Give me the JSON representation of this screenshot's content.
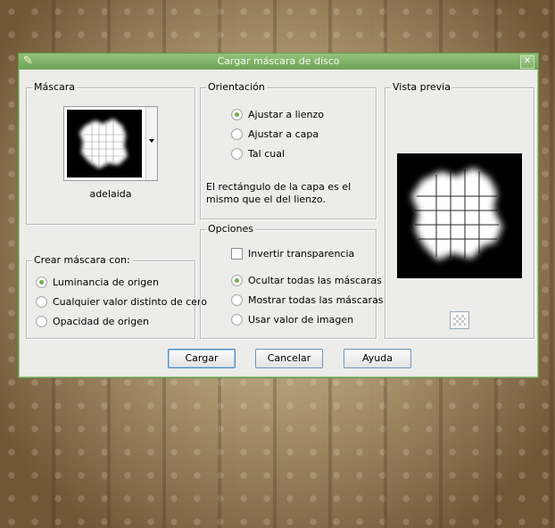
{
  "dialog": {
    "title": "Cargar máscara de disco",
    "close_glyph": "✕"
  },
  "mascara": {
    "legend": "Máscara",
    "selected_name": "adelaida"
  },
  "orientacion": {
    "legend": "Orientación",
    "options": [
      "Ajustar a lienzo",
      "Ajustar a capa",
      "Tal cual"
    ],
    "selected": 0,
    "description": "El rectángulo de la capa es el mismo que el del lienzo."
  },
  "vista_previa": {
    "legend": "Vista previa"
  },
  "crear": {
    "legend": "Crear máscara con:",
    "options": [
      "Luminancia de origen",
      "Cualquier valor distinto de cero",
      "Opacidad de origen"
    ],
    "selected": 0
  },
  "opciones": {
    "legend": "Opciones",
    "invert_label": "Invertir transparencia",
    "invert_checked": false,
    "options": [
      "Ocultar todas las máscaras",
      "Mostrar todas las máscaras",
      "Usar valor de imagen"
    ],
    "selected": 0
  },
  "buttons": {
    "cargar": "Cargar",
    "cancelar": "Cancelar",
    "ayuda": "Ayuda"
  },
  "icons": {
    "app": "paintbrush-icon",
    "close": "close-icon",
    "dropdown": "chevron-down-icon",
    "preview_toggle": "checkerboard-icon"
  },
  "colors": {
    "titlebar": "#7fb069",
    "radio_selected": "#6fae4c",
    "button_border": "#6d95b8"
  }
}
